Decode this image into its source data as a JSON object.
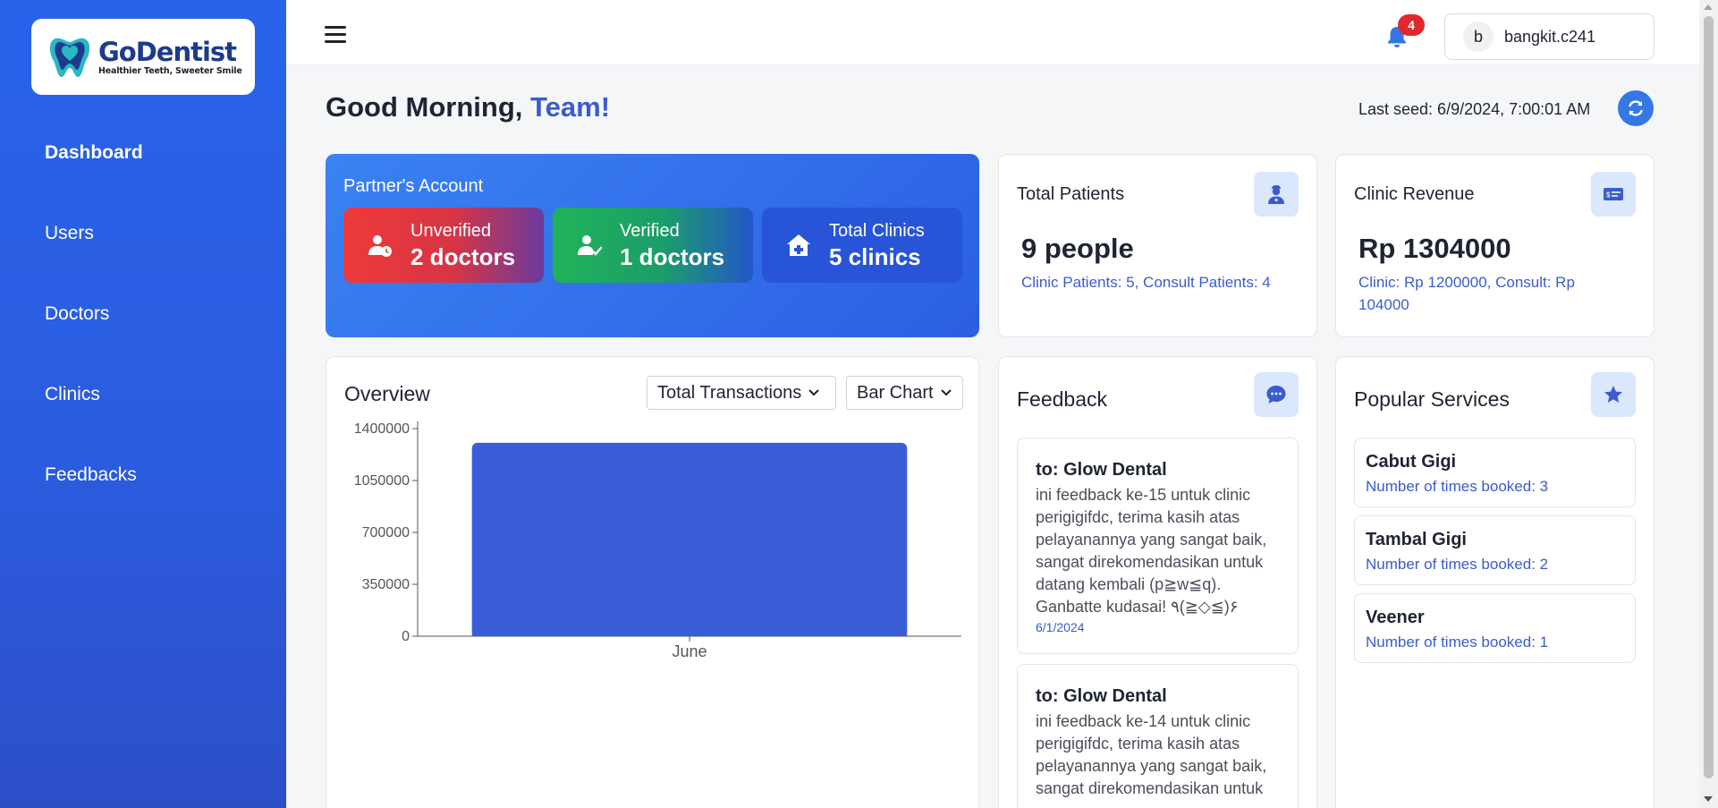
{
  "brand": {
    "name_prefix": "Go",
    "name_suffix": "Dentist",
    "tagline": "Healthier Teeth, Sweeter Smile"
  },
  "sidebar": {
    "items": [
      {
        "label": "Dashboard",
        "active": true
      },
      {
        "label": "Users"
      },
      {
        "label": "Doctors"
      },
      {
        "label": "Clinics"
      },
      {
        "label": "Feedbacks"
      }
    ]
  },
  "topbar": {
    "notification_count": "4",
    "user_initial": "b",
    "username": "bangkit.c241"
  },
  "greeting": {
    "prefix": "Good Morning, ",
    "name": "Team!"
  },
  "last_seed": "Last seed: 6/9/2024, 7:00:01 AM",
  "partner": {
    "title": "Partner's Account",
    "unverified_label": "Unverified",
    "unverified_value": "2 doctors",
    "verified_label": "Verified",
    "verified_value": "1 doctors",
    "clinics_label": "Total Clinics",
    "clinics_value": "5 clinics"
  },
  "patients": {
    "title": "Total Patients",
    "value": "9 people",
    "sub": "Clinic Patients: 5, Consult Patients: 4"
  },
  "revenue": {
    "title": "Clinic Revenue",
    "value": "Rp 1304000",
    "sub": "Clinic: Rp 1200000, Consult: Rp 104000"
  },
  "overview": {
    "title": "Overview",
    "metric_select": "Total Transactions",
    "chart_select": "Bar Chart"
  },
  "chart_data": {
    "type": "bar",
    "categories": [
      "June"
    ],
    "values": [
      1304000
    ],
    "ylim": [
      0,
      1400000
    ],
    "yticks": [
      "0",
      "350000",
      "700000",
      "1050000",
      "1400000"
    ],
    "title": "",
    "xlabel": "",
    "ylabel": "",
    "bar_color": "#3a5ed8"
  },
  "feedback": {
    "title": "Feedback",
    "items": [
      {
        "to": "to: Glow Dental",
        "text": "ini feedback ke-15 untuk clinic perigigifdc, terima kasih atas pelayanannya yang sangat baik, sangat direkomendasikan untuk datang kembali (p≧w≦q). Ganbatte kudasai! ٩(≧◇≦)۶",
        "date": "6/1/2024"
      },
      {
        "to": "to: Glow Dental",
        "text": "ini feedback ke-14 untuk clinic perigigifdc, terima kasih atas pelayanannya yang sangat baik, sangat direkomendasikan untuk",
        "date": ""
      }
    ]
  },
  "popular": {
    "title": "Popular Services",
    "items": [
      {
        "name": "Cabut Gigi",
        "count": "Number of times booked: 3"
      },
      {
        "name": "Tambal Gigi",
        "count": "Number of times booked: 2"
      },
      {
        "name": "Veener",
        "count": "Number of times booked: 1"
      }
    ]
  },
  "colors": {
    "accent": "#3a5ccc",
    "sidebar": "#2863ea",
    "badge": "#e0282e"
  }
}
